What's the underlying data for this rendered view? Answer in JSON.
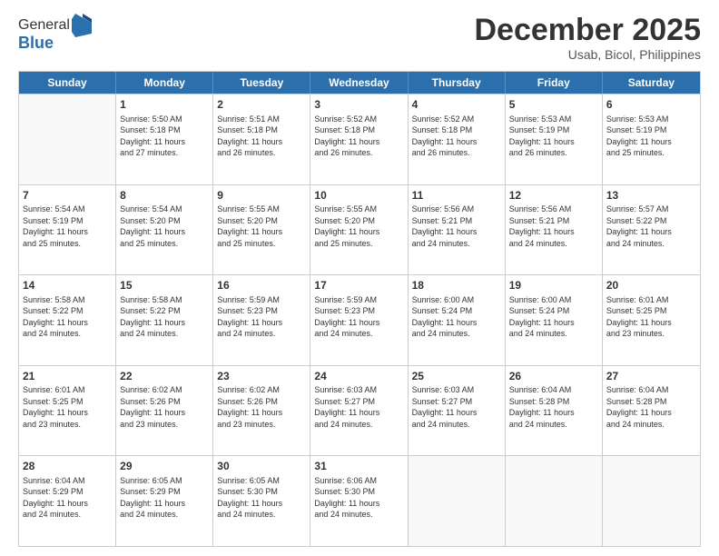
{
  "logo": {
    "general": "General",
    "blue": "Blue"
  },
  "title": "December 2025",
  "location": "Usab, Bicol, Philippines",
  "days": [
    "Sunday",
    "Monday",
    "Tuesday",
    "Wednesday",
    "Thursday",
    "Friday",
    "Saturday"
  ],
  "weeks": [
    [
      {
        "day": "",
        "info": ""
      },
      {
        "day": "1",
        "info": "Sunrise: 5:50 AM\nSunset: 5:18 PM\nDaylight: 11 hours\nand 27 minutes."
      },
      {
        "day": "2",
        "info": "Sunrise: 5:51 AM\nSunset: 5:18 PM\nDaylight: 11 hours\nand 26 minutes."
      },
      {
        "day": "3",
        "info": "Sunrise: 5:52 AM\nSunset: 5:18 PM\nDaylight: 11 hours\nand 26 minutes."
      },
      {
        "day": "4",
        "info": "Sunrise: 5:52 AM\nSunset: 5:18 PM\nDaylight: 11 hours\nand 26 minutes."
      },
      {
        "day": "5",
        "info": "Sunrise: 5:53 AM\nSunset: 5:19 PM\nDaylight: 11 hours\nand 26 minutes."
      },
      {
        "day": "6",
        "info": "Sunrise: 5:53 AM\nSunset: 5:19 PM\nDaylight: 11 hours\nand 25 minutes."
      }
    ],
    [
      {
        "day": "7",
        "info": "Sunrise: 5:54 AM\nSunset: 5:19 PM\nDaylight: 11 hours\nand 25 minutes."
      },
      {
        "day": "8",
        "info": "Sunrise: 5:54 AM\nSunset: 5:20 PM\nDaylight: 11 hours\nand 25 minutes."
      },
      {
        "day": "9",
        "info": "Sunrise: 5:55 AM\nSunset: 5:20 PM\nDaylight: 11 hours\nand 25 minutes."
      },
      {
        "day": "10",
        "info": "Sunrise: 5:55 AM\nSunset: 5:20 PM\nDaylight: 11 hours\nand 25 minutes."
      },
      {
        "day": "11",
        "info": "Sunrise: 5:56 AM\nSunset: 5:21 PM\nDaylight: 11 hours\nand 24 minutes."
      },
      {
        "day": "12",
        "info": "Sunrise: 5:56 AM\nSunset: 5:21 PM\nDaylight: 11 hours\nand 24 minutes."
      },
      {
        "day": "13",
        "info": "Sunrise: 5:57 AM\nSunset: 5:22 PM\nDaylight: 11 hours\nand 24 minutes."
      }
    ],
    [
      {
        "day": "14",
        "info": "Sunrise: 5:58 AM\nSunset: 5:22 PM\nDaylight: 11 hours\nand 24 minutes."
      },
      {
        "day": "15",
        "info": "Sunrise: 5:58 AM\nSunset: 5:22 PM\nDaylight: 11 hours\nand 24 minutes."
      },
      {
        "day": "16",
        "info": "Sunrise: 5:59 AM\nSunset: 5:23 PM\nDaylight: 11 hours\nand 24 minutes."
      },
      {
        "day": "17",
        "info": "Sunrise: 5:59 AM\nSunset: 5:23 PM\nDaylight: 11 hours\nand 24 minutes."
      },
      {
        "day": "18",
        "info": "Sunrise: 6:00 AM\nSunset: 5:24 PM\nDaylight: 11 hours\nand 24 minutes."
      },
      {
        "day": "19",
        "info": "Sunrise: 6:00 AM\nSunset: 5:24 PM\nDaylight: 11 hours\nand 24 minutes."
      },
      {
        "day": "20",
        "info": "Sunrise: 6:01 AM\nSunset: 5:25 PM\nDaylight: 11 hours\nand 23 minutes."
      }
    ],
    [
      {
        "day": "21",
        "info": "Sunrise: 6:01 AM\nSunset: 5:25 PM\nDaylight: 11 hours\nand 23 minutes."
      },
      {
        "day": "22",
        "info": "Sunrise: 6:02 AM\nSunset: 5:26 PM\nDaylight: 11 hours\nand 23 minutes."
      },
      {
        "day": "23",
        "info": "Sunrise: 6:02 AM\nSunset: 5:26 PM\nDaylight: 11 hours\nand 23 minutes."
      },
      {
        "day": "24",
        "info": "Sunrise: 6:03 AM\nSunset: 5:27 PM\nDaylight: 11 hours\nand 24 minutes."
      },
      {
        "day": "25",
        "info": "Sunrise: 6:03 AM\nSunset: 5:27 PM\nDaylight: 11 hours\nand 24 minutes."
      },
      {
        "day": "26",
        "info": "Sunrise: 6:04 AM\nSunset: 5:28 PM\nDaylight: 11 hours\nand 24 minutes."
      },
      {
        "day": "27",
        "info": "Sunrise: 6:04 AM\nSunset: 5:28 PM\nDaylight: 11 hours\nand 24 minutes."
      }
    ],
    [
      {
        "day": "28",
        "info": "Sunrise: 6:04 AM\nSunset: 5:29 PM\nDaylight: 11 hours\nand 24 minutes."
      },
      {
        "day": "29",
        "info": "Sunrise: 6:05 AM\nSunset: 5:29 PM\nDaylight: 11 hours\nand 24 minutes."
      },
      {
        "day": "30",
        "info": "Sunrise: 6:05 AM\nSunset: 5:30 PM\nDaylight: 11 hours\nand 24 minutes."
      },
      {
        "day": "31",
        "info": "Sunrise: 6:06 AM\nSunset: 5:30 PM\nDaylight: 11 hours\nand 24 minutes."
      },
      {
        "day": "",
        "info": ""
      },
      {
        "day": "",
        "info": ""
      },
      {
        "day": "",
        "info": ""
      }
    ]
  ]
}
